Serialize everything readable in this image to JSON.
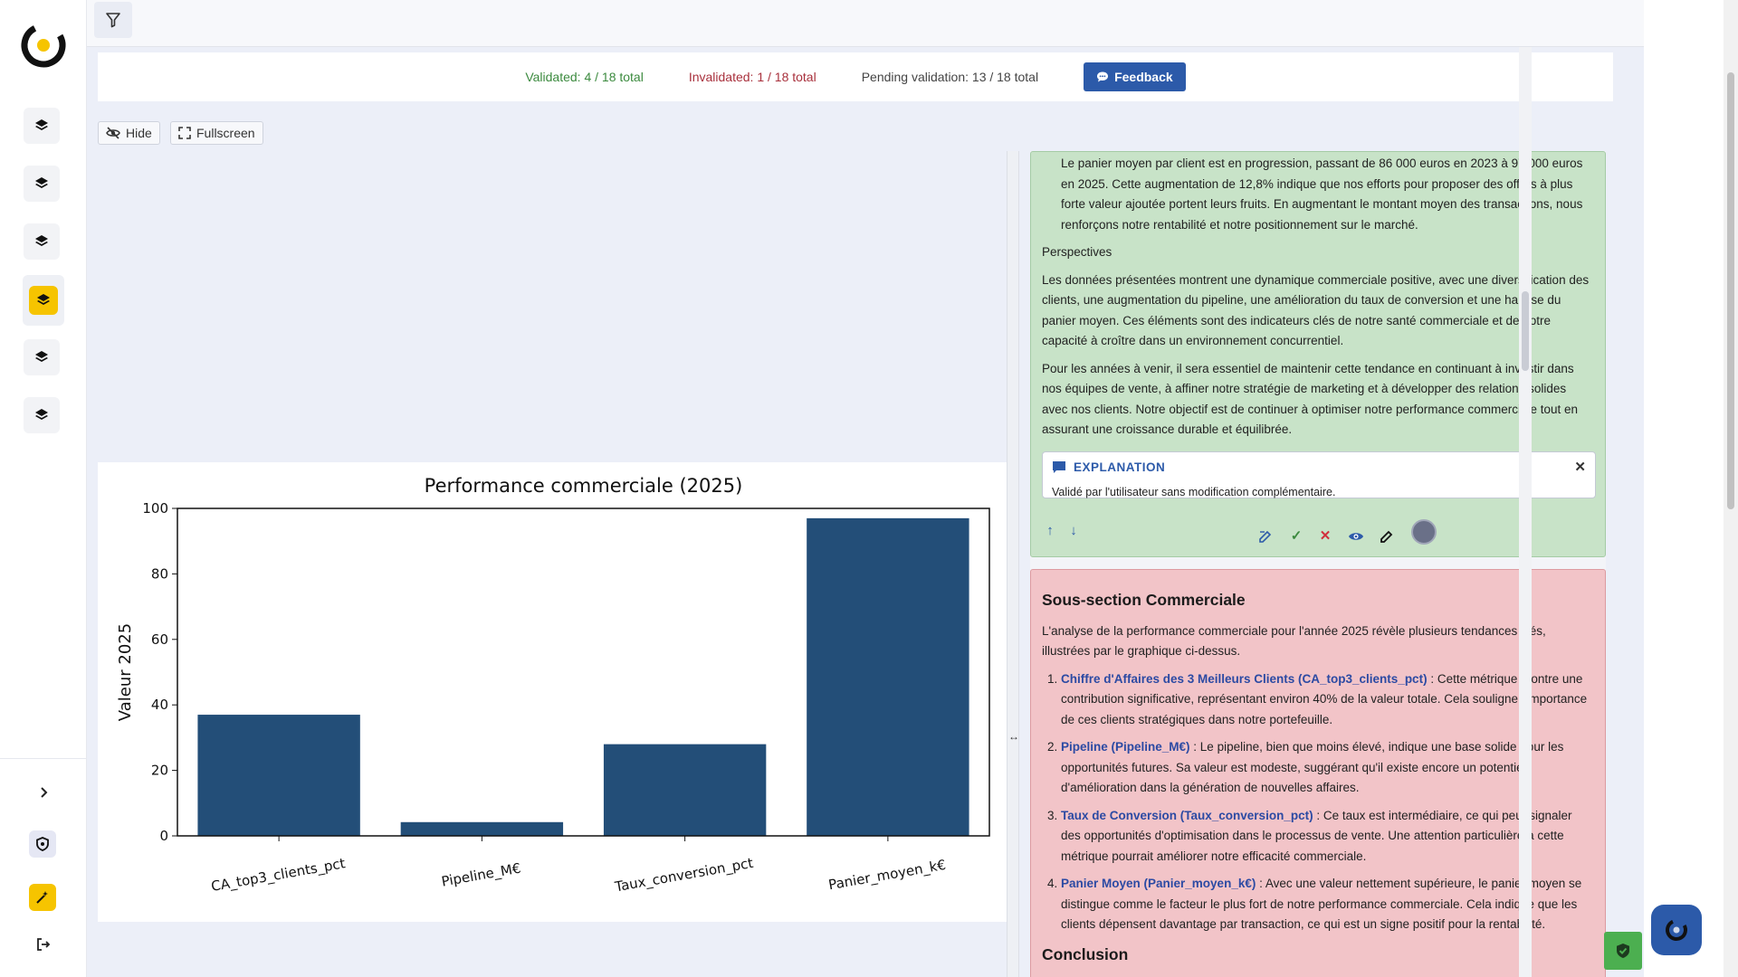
{
  "status": {
    "validated": "Validated: 4 / 18 total",
    "invalidated": "Invalidated: 1 / 18 total",
    "pending": "Pending validation: 13 / 18 total",
    "feedback_label": "Feedback"
  },
  "toolbar": {
    "hide_label": "Hide",
    "fullscreen_label": "Fullscreen"
  },
  "chart_data": {
    "type": "bar",
    "title": "Performance commerciale (2025)",
    "xlabel": "",
    "ylabel": "Valeur 2025",
    "categories": [
      "CA_top3_clients_pct",
      "Pipeline_M€",
      "Taux_conversion_pct",
      "Panier_moyen_k€"
    ],
    "values": [
      37,
      4.2,
      28,
      97
    ],
    "ylim": [
      0,
      100
    ],
    "yticks": [
      0,
      20,
      40,
      60,
      80,
      100
    ],
    "grid": false,
    "bar_color": "#234e78"
  },
  "validated_card": {
    "para1": "Le panier moyen par client est en progression, passant de 86 000 euros en 2023 à 97 000 euros en 2025. Cette augmentation de 12,8% indique que nos efforts pour proposer des offres à plus forte valeur ajoutée portent leurs fruits. En augmentant le montant moyen des transactions, nous renforçons notre rentabilité et notre positionnement sur le marché.",
    "heading": "Perspectives",
    "para2": "Les données présentées montrent une dynamique commerciale positive, avec une diversification des clients, une augmentation du pipeline, une amélioration du taux de conversion et une hausse du panier moyen. Ces éléments sont des indicateurs clés de notre santé commerciale et de notre capacité à croître dans un environnement concurrentiel.",
    "para3": "Pour les années à venir, il sera essentiel de maintenir cette tendance en continuant à investir dans nos équipes de vente, à affiner notre stratégie de marketing et à développer des relations solides avec nos clients. Notre objectif est de continuer à optimiser notre performance commerciale tout en assurant une croissance durable et équilibrée.",
    "explanation_title": "EXPLANATION",
    "explanation_text": "Validé par l'utilisateur sans modification complémentaire."
  },
  "invalid_card": {
    "title": "Sous-section Commerciale",
    "intro": "L'analyse de la performance commerciale pour l'année 2025 révèle plusieurs tendances clés, illustrées par le graphique ci-dessus.",
    "items": [
      {
        "term": "Chiffre d'Affaires des 3 Meilleurs Clients (CA_top3_clients_pct)",
        "text": " : Cette métrique montre une contribution significative, représentant environ 40% de la valeur totale. Cela souligne l'importance de ces clients stratégiques dans notre portefeuille."
      },
      {
        "term": "Pipeline (Pipeline_M€)",
        "text": " : Le pipeline, bien que moins élevé, indique une base solide pour les opportunités futures. Sa valeur est modeste, suggérant qu'il existe encore un potentiel d'amélioration dans la génération de nouvelles affaires."
      },
      {
        "term": "Taux de Conversion (Taux_conversion_pct)",
        "text": " : Ce taux est intermédiaire, ce qui peut signaler des opportunités d'optimisation dans le processus de vente. Une attention particulière à cette métrique pourrait améliorer notre efficacité commerciale."
      },
      {
        "term": "Panier Moyen (Panier_moyen_k€)",
        "text": " : Avec une valeur nettement supérieure, le panier moyen se distingue comme le facteur le plus fort de notre performance commerciale. Cela indique que les clients dépensent davantage par transaction, ce qui est un signe positif pour la rentabilité."
      }
    ],
    "conclusion": "Conclusion"
  },
  "colors": {
    "accent_yellow": "#f6c400",
    "primary_blue": "#2c5aa9",
    "validated_green": "#c8e3c8",
    "invalidated_red": "#f2c4c8"
  },
  "icons": {
    "sidebar": [
      "layers-icon",
      "layers-icon",
      "layers-icon",
      "layers-icon",
      "layers-icon",
      "layers-icon"
    ],
    "filter": "filter-icon",
    "feedback": "chat-bubble-icon",
    "hide": "eye-off-icon",
    "fullscreen": "fullscreen-icon"
  }
}
